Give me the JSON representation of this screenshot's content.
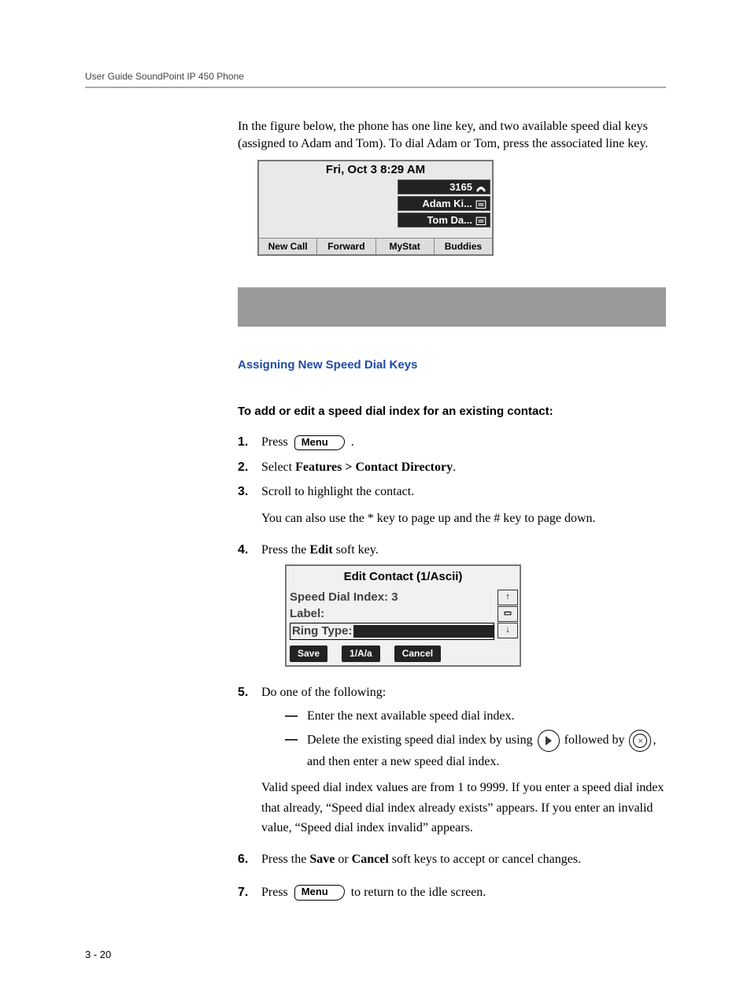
{
  "header": "User Guide SoundPoint IP 450 Phone",
  "intro": "In the figure below, the phone has one line key, and two available speed dial keys (assigned to Adam and Tom). To dial Adam or Tom, press the associated line key.",
  "fig1": {
    "title": "Fri, Oct 3  8:29 AM",
    "line_keys": [
      "3165",
      "Adam Ki...",
      "Tom Da..."
    ],
    "softkeys": [
      "New Call",
      "Forward",
      "MyStat",
      "Buddies"
    ]
  },
  "section_title": "Assigning New Speed Dial Keys",
  "subhead": "To add or edit a speed dial index for an existing contact:",
  "steps": {
    "s1_a": "Press",
    "s1_menu": "Menu",
    "s1_b": ".",
    "s2_a": "Select ",
    "s2_b": "Features > Contact Directory",
    "s2_c": ".",
    "s3_a": "Scroll to highlight the contact.",
    "s3_b": "You can also use the * key to page up and the # key to page down.",
    "s4_a": "Press the ",
    "s4_b": "Edit",
    "s4_c": " soft key.",
    "s5_a": "Do one of the following:",
    "s5_sub1": "Enter the next available speed dial index.",
    "s5_sub2_a": "Delete the existing speed dial index by using",
    "s5_sub2_b": "followed by",
    "s5_sub2_c": ", and then enter a new speed dial index.",
    "s5_valid": "Valid speed dial index values are from 1 to 9999. If you enter a speed dial index that already, “Speed dial index already exists” appears. If you enter an invalid value, “Speed dial index invalid” appears.",
    "s6_a": "Press the ",
    "s6_b": "Save",
    "s6_c": " or ",
    "s6_d": "Cancel",
    "s6_e": " soft keys to accept or cancel changes.",
    "s7_a": "Press",
    "s7_menu": "Menu",
    "s7_b": "to return to the idle screen."
  },
  "fig2": {
    "title": "Edit Contact (1/Ascii)",
    "rows": {
      "speed_dial": "Speed Dial Index: 3",
      "label": "Label:",
      "ring_type": "Ring Type:"
    },
    "softkeys": [
      "Save",
      "1/A/a",
      "Cancel"
    ]
  },
  "nums": {
    "n1": "1.",
    "n2": "2.",
    "n3": "3.",
    "n4": "4.",
    "n5": "5.",
    "n6": "6.",
    "n7": "7."
  },
  "dash": "—",
  "x_glyph": "×",
  "page_num": "3 - 20",
  "chart_data": {
    "type": "table",
    "title": "SoundPoint IP 450 speed dial procedure",
    "idle_screen": {
      "datetime": "Fri, Oct 3  8:29 AM",
      "line_keys": [
        {
          "slot": 1,
          "label": "3165",
          "type": "line"
        },
        {
          "slot": 2,
          "label": "Adam Ki...",
          "type": "speed_dial"
        },
        {
          "slot": 3,
          "label": "Tom Da...",
          "type": "speed_dial"
        }
      ],
      "softkeys": [
        "New Call",
        "Forward",
        "MyStat",
        "Buddies"
      ]
    },
    "edit_contact_screen": {
      "title": "Edit Contact (1/Ascii)",
      "fields": [
        {
          "name": "Speed Dial Index",
          "value": 3
        },
        {
          "name": "Label",
          "value": ""
        },
        {
          "name": "Ring Type",
          "value": "",
          "selected": true
        }
      ],
      "softkeys": [
        "Save",
        "1/A/a",
        "Cancel"
      ]
    },
    "speed_dial_index_range": [
      1,
      9999
    ]
  }
}
